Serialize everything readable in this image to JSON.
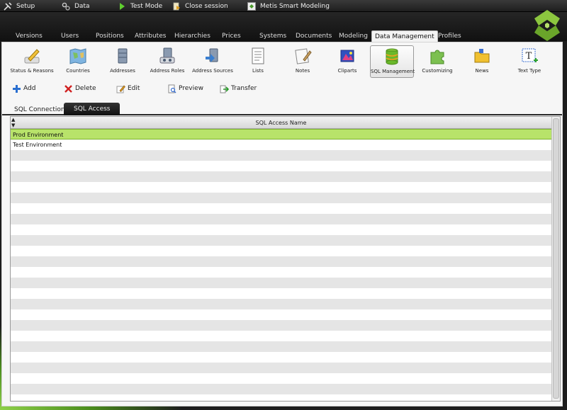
{
  "topmenu": [
    {
      "label": "Setup",
      "icon": "wrench-icon"
    },
    {
      "label": "Data",
      "icon": "cogs-icon"
    },
    {
      "label": "Test Mode",
      "icon": "play-icon"
    },
    {
      "label": "Close session",
      "icon": "document-icon"
    },
    {
      "label": "Metis Smart Modeling",
      "icon": "app-icon"
    }
  ],
  "tabs": [
    "Versions",
    "Users",
    "Positions",
    "Attributes",
    "Hierarchies",
    "Prices",
    "Systems",
    "Documents",
    "Modeling",
    "Data Management",
    "Profiles"
  ],
  "active_tab": "Data Management",
  "ribbon": [
    {
      "label": "Status & Reasons",
      "icon": "pen-icon"
    },
    {
      "label": "Countries",
      "icon": "map-icon"
    },
    {
      "label": "Addresses",
      "icon": "database-icon"
    },
    {
      "label": "Address Roles",
      "icon": "database-user-icon"
    },
    {
      "label": "Address Sources",
      "icon": "database-arrow-icon"
    },
    {
      "label": "Lists",
      "icon": "list-icon"
    },
    {
      "label": "Notes",
      "icon": "notes-icon"
    },
    {
      "label": "Cliparts",
      "icon": "clipart-icon"
    },
    {
      "label": "SQL Management",
      "icon": "sql-database-icon"
    },
    {
      "label": "Customizing",
      "icon": "puzzle-icon"
    },
    {
      "label": "News",
      "icon": "folder-icon"
    },
    {
      "label": "Text Type",
      "icon": "text-type-icon"
    }
  ],
  "active_ribbon": "SQL Management",
  "toolbar": {
    "add": "Add",
    "delete": "Delete",
    "edit": "Edit",
    "preview": "Preview",
    "transfer": "Transfer"
  },
  "subtabs": {
    "sql_connections": "SQL Connections",
    "sql_access": "SQL Access"
  },
  "grid": {
    "column": "SQL Access Name",
    "rows": [
      "Prod Environment",
      "Test Environment"
    ],
    "selected_row": "Prod Environment"
  },
  "colors": {
    "selection": "#b8e36a",
    "brand_green": "#7dc142"
  }
}
